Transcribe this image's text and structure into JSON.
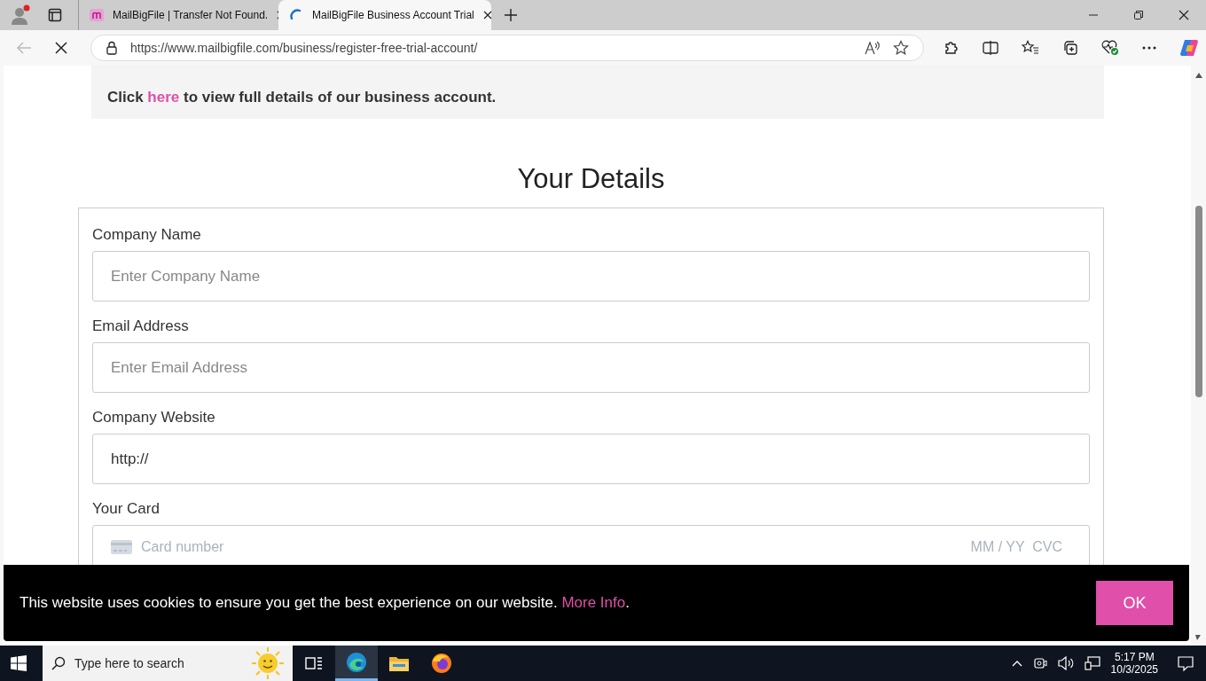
{
  "browser": {
    "tabs": [
      {
        "title": "MailBigFile | Transfer Not Found.",
        "selected": false,
        "loading": false
      },
      {
        "title": "MailBigFile Business Account Trial",
        "selected": true,
        "loading": true
      }
    ],
    "address": "https://www.mailbigfile.com/business/register-free-trial-account/"
  },
  "page": {
    "notice": {
      "before": "Click ",
      "link": "here",
      "after": " to view full details of our business account."
    },
    "heading": "Your Details",
    "fields": [
      {
        "kind": "text",
        "label": "Company Name",
        "placeholder": "Enter Company Name"
      },
      {
        "kind": "text",
        "label": "Email Address",
        "placeholder": "Enter Email Address"
      },
      {
        "kind": "text",
        "label": "Company Website",
        "value": "http://"
      },
      {
        "kind": "card",
        "label": "Your Card",
        "placeholder": "Card number",
        "extra": "MM / YY  CVC"
      }
    ]
  },
  "cookie": {
    "text": "This website uses cookies to ensure you get the best experience on our website.",
    "link": "More Info",
    "after": ".",
    "button": "OK"
  },
  "taskbar": {
    "search_placeholder": "Type here to search",
    "apps": [
      {
        "kind": "taskview",
        "selected": false
      },
      {
        "kind": "edge",
        "selected": true
      },
      {
        "kind": "folder",
        "selected": false
      },
      {
        "kind": "firefox",
        "selected": false
      }
    ],
    "time": "5:17 PM",
    "date": "10/3/2025"
  }
}
